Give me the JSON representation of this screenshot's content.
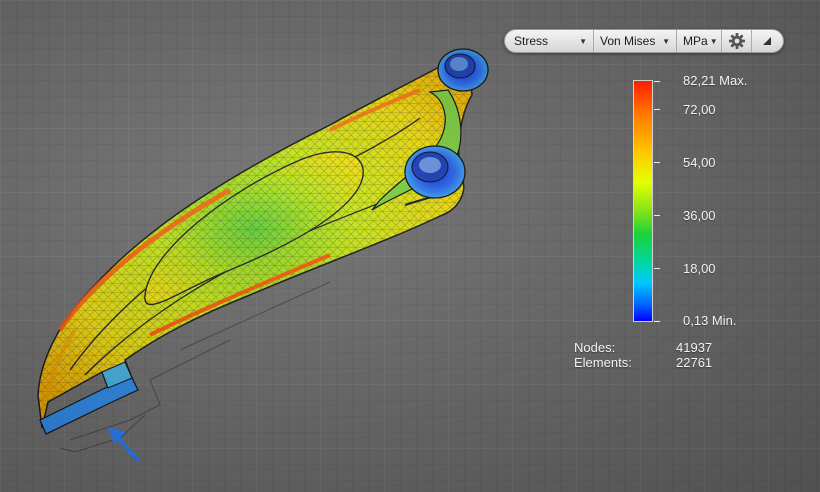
{
  "toolbar": {
    "result_quantity": "Stress",
    "result_type": "Von Mises",
    "unit": "MPa",
    "settings_icon": "gear-icon",
    "collapse_icon": "corner-triangle-icon"
  },
  "legend": {
    "max_label": "82,21 Max.",
    "ticks": [
      "72,00",
      "54,00",
      "36,00",
      "18,00"
    ],
    "min_label": "0,13 Min.",
    "colors": [
      "#ff1e00",
      "#ff7a00",
      "#ffc800",
      "#e6ff00",
      "#19d23a",
      "#00c8ff",
      "#0000ff"
    ]
  },
  "mesh_stats": {
    "nodes_label": "Nodes:",
    "nodes_value": "41937",
    "elements_label": "Elements:",
    "elements_value": "22761"
  },
  "viewport": {
    "background_color": "#707070",
    "arrow_color": "#2a7fff",
    "load_marker_icon": "blue-arrow-icon"
  }
}
